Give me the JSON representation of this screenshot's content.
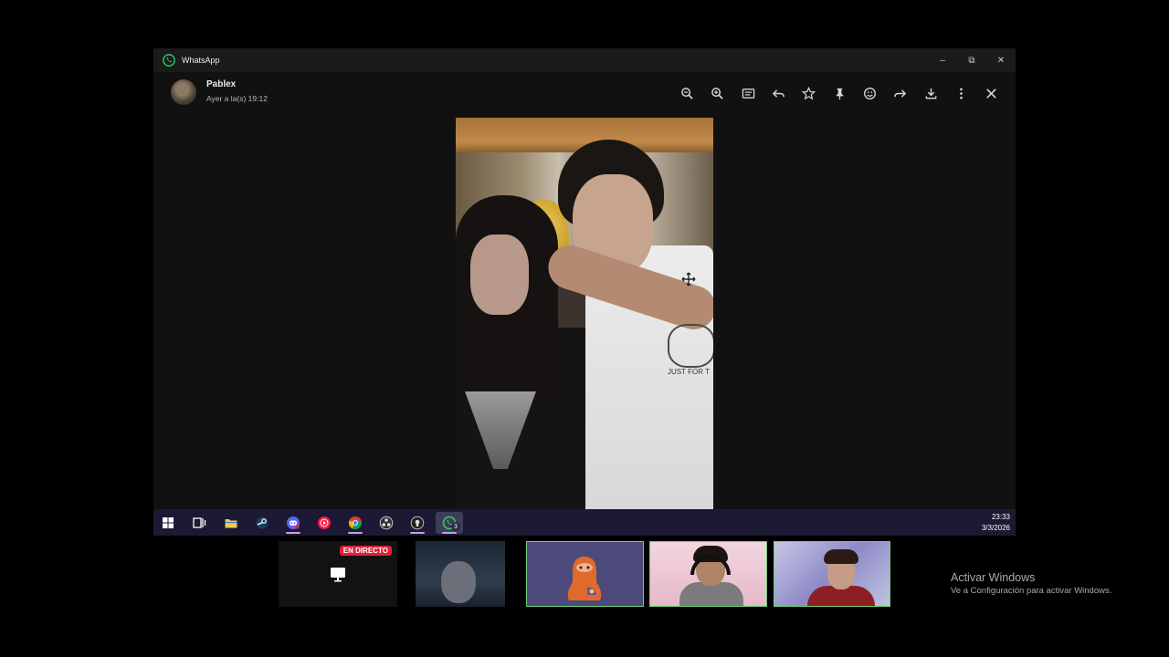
{
  "window": {
    "app_title": "WhatsApp",
    "controls": {
      "minimize": "–",
      "restore": "⧉",
      "close": "✕"
    }
  },
  "viewer": {
    "contact_name": "Pablex",
    "timestamp": "Ayer a la(s) 19:12",
    "toolbar": [
      "zoom-out-icon",
      "zoom-in-icon",
      "caption-icon",
      "reply-icon",
      "star-icon",
      "pin-icon",
      "react-icon",
      "forward-icon",
      "download-icon",
      "more-icon",
      "close-icon"
    ],
    "photo_text": "JUST FOR T"
  },
  "taskbar": {
    "apps": [
      "windows-start-icon",
      "task-view-icon",
      "file-explorer-icon",
      "steam-icon",
      "discord-icon",
      "youtube-music-icon",
      "chrome-icon",
      "obs-icon",
      "app-icon",
      "whatsapp-icon"
    ],
    "whatsapp_badge": "3",
    "time": "23:33",
    "date": "3/3/2026",
    "underline_color": "#c9a0dc",
    "background": "#1b1934"
  },
  "call": {
    "live_label": "EN DIRECTO",
    "live_color": "#e0203a",
    "speaking_border": "#6fcf7a"
  },
  "watermark": {
    "title": "Activar Windows",
    "subtitle": "Ve a Configuración para activar Windows."
  }
}
